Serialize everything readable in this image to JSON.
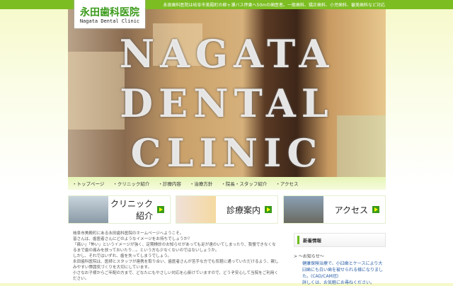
{
  "header": {
    "tagline": "永田歯科医院は岐阜市美殿町の柳ヶ瀬バス停東へ50mの歯医者。一般歯科、矯正歯科、小児歯科、審美歯科など対応",
    "logo_jp": "永田歯科医院",
    "logo_en": "Nagata Dental Clinic"
  },
  "hero": {
    "line1": "NAGATA",
    "line2": "DENTAL",
    "line3": "CLINIC"
  },
  "nav": [
    "・トップページ",
    "・クリニック紹介",
    "・診療内容",
    "・治療方針",
    "・院長・スタッフ紹介",
    "・アクセス"
  ],
  "banners": [
    "クリニック紹介",
    "診療案内",
    "アクセス"
  ],
  "content": [
    "岐阜市美殿町にある永田歯科医院のホームページへようこそ。",
    "皆さんは、歯医者さんにどのようなイメージをお持ちでしょうか？",
    "「痛い」「怖い」というイメージが強く、定期検診のお知らせがあっても足が遠のいてしまったり、我慢できなくなるまで歯の痛みを放っておいたり…。という方も少なくないのではないしょうか。",
    "しかし、それではいずれ、歯を失ってしまうでしょう。",
    "永田歯科医院は、医師とスタッフが連携を取り合い、歯医者さんが苦手な方でも気軽に通っていただけるよう、親しみやすい雰囲気づくりを大切にしています。",
    "小さなお子様からご年配の方まで、どなたにもやさしい対応を心掛けていますので、どうぞ安心して当院をご利用ください。"
  ],
  "sidebar": {
    "title": "新着情報",
    "category": "> ～お知らせ～",
    "news": "健康保険治療で、小臼歯とケースにより大臼歯にも白い歯を被せられる様になりました。(CAD/CAM冠)",
    "more": "詳しくは、お気軽にお尋ねください。"
  }
}
